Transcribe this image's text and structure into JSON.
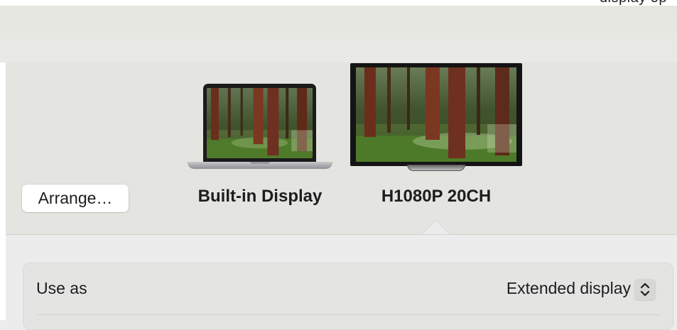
{
  "header": {
    "cut_off_text": "display op"
  },
  "arrangement": {
    "arrange_button_label": "Arrange…",
    "displays": [
      {
        "name": "Built-in Display",
        "kind": "laptop"
      },
      {
        "name": "H1080P 20CH",
        "kind": "monitor",
        "selected": true
      }
    ]
  },
  "settings": {
    "use_as": {
      "label": "Use as",
      "value": "Extended display"
    }
  },
  "icons": {
    "stepper": "up-down-chevron-icon"
  }
}
